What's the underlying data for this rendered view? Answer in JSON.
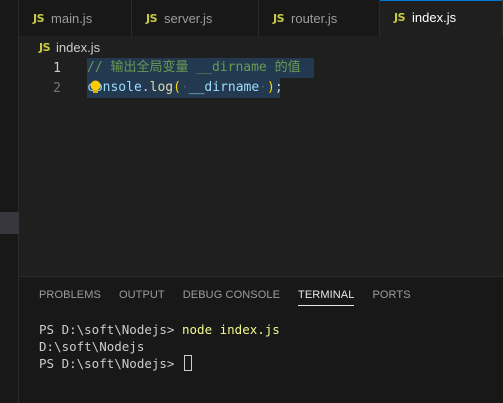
{
  "tabs": [
    {
      "icon": "JS",
      "label": "main.js",
      "active": false
    },
    {
      "icon": "JS",
      "label": "server.js",
      "active": false
    },
    {
      "icon": "JS",
      "label": "router.js",
      "active": false
    },
    {
      "icon": "JS",
      "label": "index.js",
      "active": true
    }
  ],
  "breadcrumb": {
    "icon": "JS",
    "file": "index.js"
  },
  "editor": {
    "lines": [
      {
        "number": "1",
        "comment": "// 输出全局变量 __dirname 的值"
      },
      {
        "number": "2",
        "object": "console",
        "dot": ".",
        "method": "log",
        "open": "(",
        "arg": "__dirname",
        "close": ")",
        "semi": ";"
      }
    ]
  },
  "panel": {
    "tabs": [
      "PROBLEMS",
      "OUTPUT",
      "DEBUG CONSOLE",
      "TERMINAL",
      "PORTS"
    ],
    "active_tab": "TERMINAL"
  },
  "terminal": {
    "line1_prompt": "PS D:\\soft\\Nodejs> ",
    "line1_command": "node index.js",
    "line2_output": "D:\\soft\\Nodejs",
    "line3_prompt": "PS D:\\soft\\Nodejs> "
  },
  "colors": {
    "editor_bg": "#1f1f1f",
    "accent": "#0078d4",
    "js_icon": "#cbcb41",
    "comment": "#6a9955",
    "selection": "#264f78"
  }
}
